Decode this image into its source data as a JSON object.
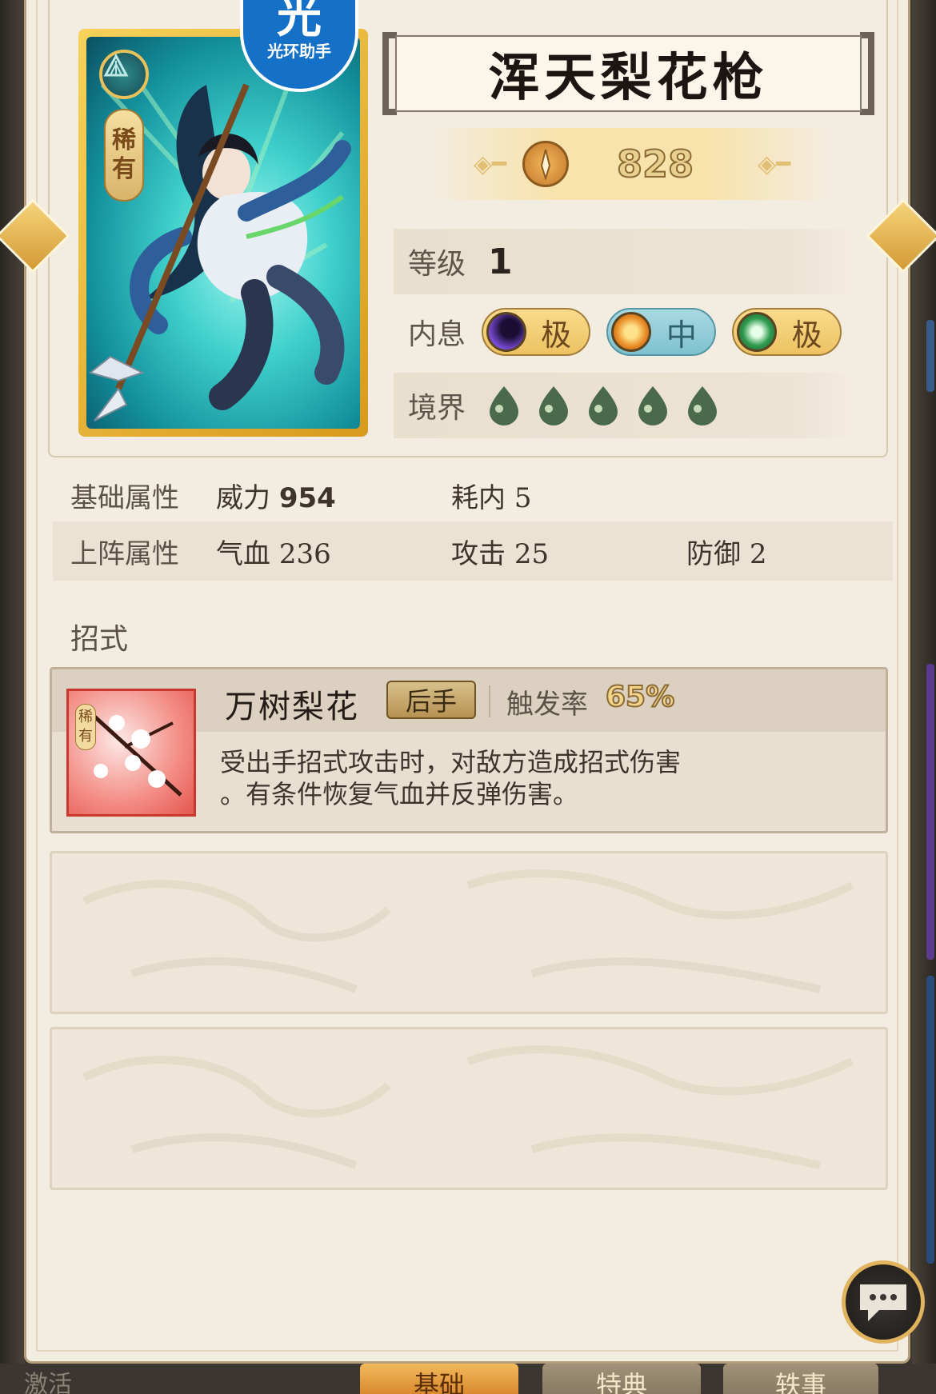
{
  "watermark": {
    "logo": "光",
    "text": "光环助手"
  },
  "card": {
    "rarity": "稀有",
    "rarity_line1": "稀",
    "rarity_line2": "有"
  },
  "weapon": {
    "name": "浑天梨花枪",
    "power": "828"
  },
  "info": {
    "level_label": "等级",
    "level_value": "1",
    "neixi_label": "内息",
    "neixi": [
      {
        "grade": "极",
        "color": "#5a2aa8",
        "icon": "moon-orb-icon"
      },
      {
        "grade": "中",
        "color": "#e88a24",
        "icon": "sun-orb-icon"
      },
      {
        "grade": "极",
        "color": "#2f9a4e",
        "icon": "crescent-orb-icon"
      }
    ],
    "realm_label": "境界",
    "realm_count": 5
  },
  "attributes": {
    "base_label": "基础属性",
    "base": {
      "power_label": "威力",
      "power_value": "954",
      "cost_label": "耗内",
      "cost_value": "5"
    },
    "deploy_label": "上阵属性",
    "deploy": {
      "hp_label": "气血",
      "hp_value": "236",
      "atk_label": "攻击",
      "atk_value": "25",
      "def_label": "防御",
      "def_value": "2"
    }
  },
  "moves": {
    "section_title": "招式",
    "skill": {
      "icon_tag": "稀有",
      "name": "万树梨花",
      "badge": "后手",
      "rate_label": "触发率",
      "rate_value": "65%",
      "description_line1": "受出手招式攻击时，对敌方造成招式伤害",
      "description_line2": "。有条件恢复气血并反弹伤害。"
    }
  },
  "tabs": {
    "activate": "激活",
    "basic": "基础",
    "classic": "特典",
    "story": "轶事"
  },
  "colors": {
    "card_gold": "#f6d25a",
    "panel_bg": "#f3ece0",
    "accent_orange": "#d98a2e"
  }
}
